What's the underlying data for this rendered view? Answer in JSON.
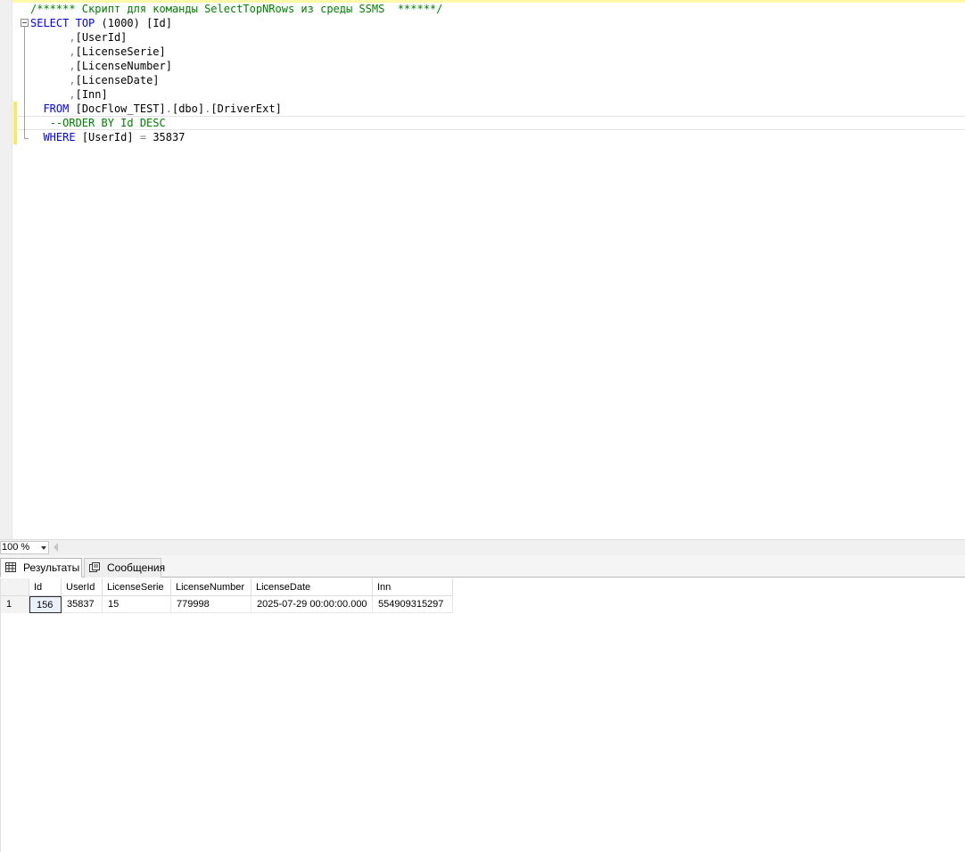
{
  "editor": {
    "lines": [
      {
        "comment": "/****** Скрипт для команды SelectTopNRows из среды SSMS  ******/"
      },
      {
        "kw_select": "SELECT",
        "kw_top": "TOP",
        "num": "(1000)",
        "ident": "[Id]"
      },
      {
        "comma": ",",
        "ident": "[UserId]"
      },
      {
        "comma": ",",
        "ident": "[LicenseSerie]"
      },
      {
        "comma": ",",
        "ident": "[LicenseNumber]"
      },
      {
        "comma": ",",
        "ident": "[LicenseDate]"
      },
      {
        "comma": ",",
        "ident": "[Inn]"
      },
      {
        "kw": "FROM",
        "db": "[DocFlow_TEST]",
        "dot1": ".",
        "schema": "[dbo]",
        "dot2": ".",
        "table": "[DriverExt]"
      },
      {
        "comment": "--ORDER BY Id DESC"
      },
      {
        "kw": "WHERE",
        "ident": "[UserId]",
        "op": "=",
        "num": "35837"
      }
    ]
  },
  "zoom": {
    "value": "100 %"
  },
  "tabs": [
    {
      "label": "Результаты",
      "icon": "grid-icon",
      "active": true
    },
    {
      "label": "Сообщения",
      "icon": "messages-icon",
      "active": false
    }
  ],
  "results": {
    "columns": [
      "Id",
      "UserId",
      "LicenseSerie",
      "LicenseNumber",
      "LicenseDate",
      "Inn"
    ],
    "rows": [
      {
        "num": "1",
        "cells": [
          "156",
          "35837",
          "15",
          "779998",
          "2025-07-29 00:00:00.000",
          "554909315297"
        ]
      }
    ]
  },
  "colors": {
    "keyword": "#0000ff",
    "comment": "#008000",
    "operator": "#808080",
    "change_bar": "#f7e96a"
  }
}
